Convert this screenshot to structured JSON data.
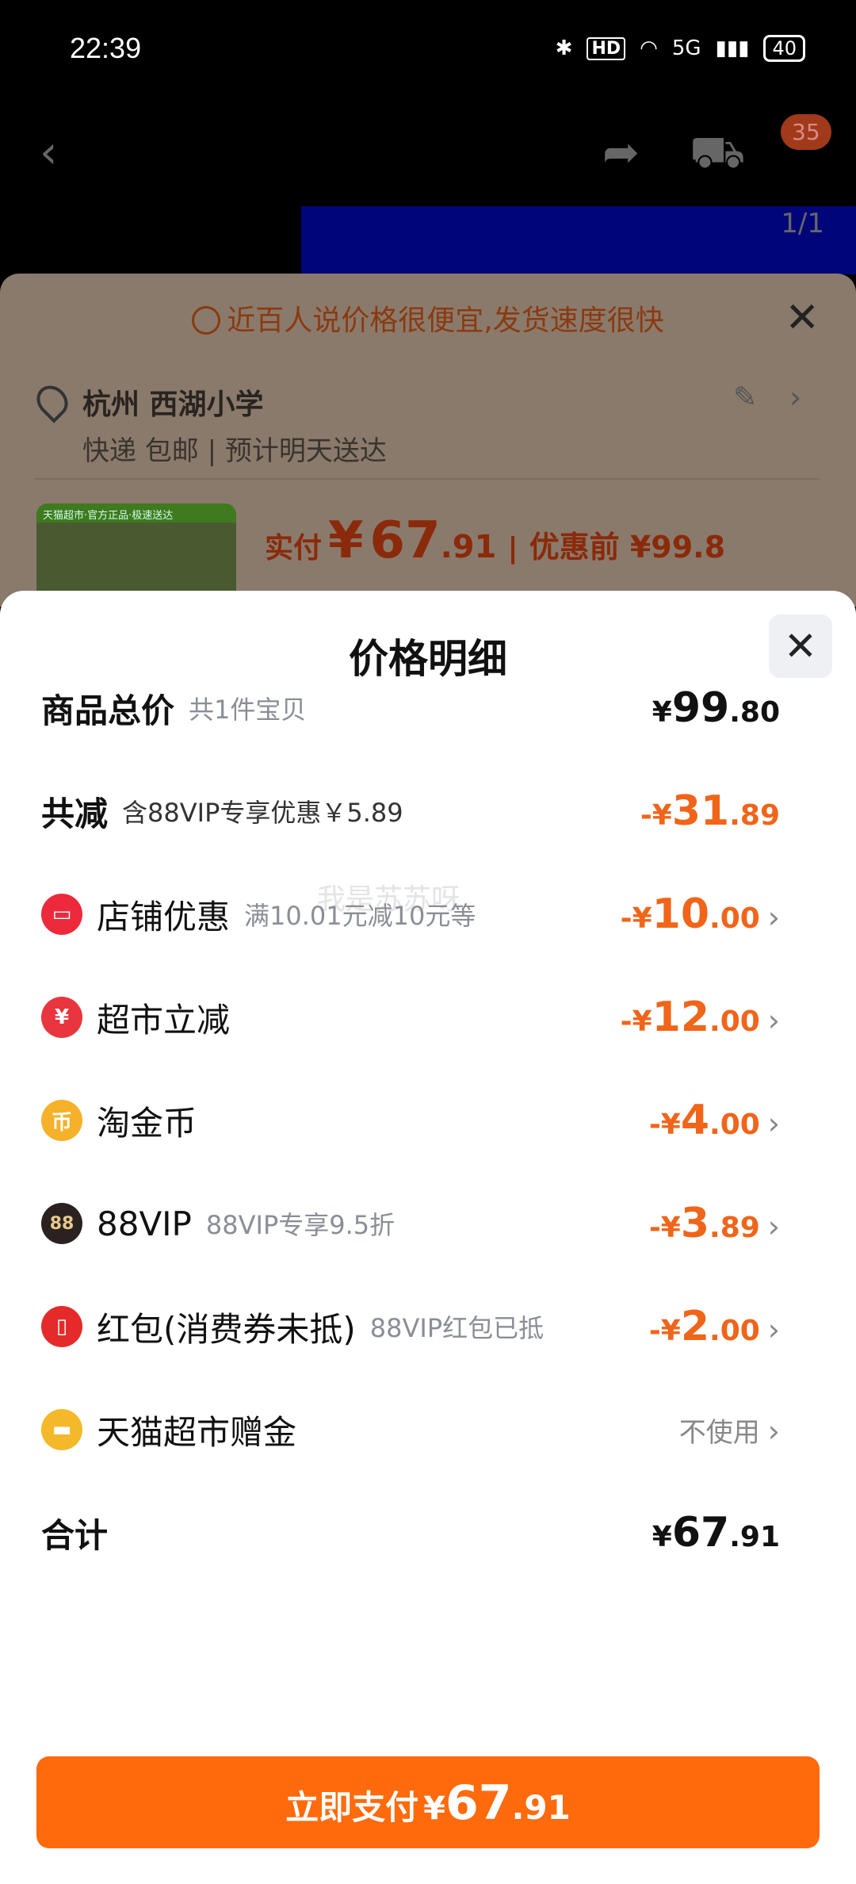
{
  "status_bar": {
    "time": "22:39",
    "bluetooth_icon": "bluetooth-icon",
    "hd": "HD",
    "wifi_icon": "wifi-icon",
    "network": "5G",
    "battery": "40"
  },
  "product_page": {
    "cart_badge": "35",
    "image_counter": "1/1"
  },
  "order_sheet": {
    "notice": "近百人说价格很便宜,发货速度很快",
    "address_title": "杭州 西湖小学",
    "address_sub": "快递 包邮 | 预计明天送达",
    "thumb_banner": "天猫超市·官方正品·极速送达",
    "paid_label": "实付",
    "paid_yen": "¥",
    "paid_int": "67",
    "paid_dec": ".91",
    "paid_before": "优惠前 ¥99.8"
  },
  "modal": {
    "title": "价格明细",
    "watermark": "我是苏苏呀",
    "rows": [
      {
        "label": "商品总价",
        "sub": "共1件宝贝",
        "yen": "¥",
        "int": "99",
        "dec": ".80"
      },
      {
        "label": "共减",
        "sub": "含88VIP专享优惠￥5.89",
        "yen": "-¥",
        "int": "31",
        "dec": ".89"
      },
      {
        "label": "店铺优惠",
        "sub": "满10.01元减10元等",
        "yen": "-¥",
        "int": "10",
        "dec": ".00"
      },
      {
        "label": "超市立减",
        "sub": "",
        "yen": "-¥",
        "int": "12",
        "dec": ".00"
      },
      {
        "label": "淘金币",
        "sub": "",
        "yen": "-¥",
        "int": "4",
        "dec": ".00"
      },
      {
        "label": "88VIP",
        "sub": "88VIP专享9.5折",
        "yen": "-¥",
        "int": "3",
        "dec": ".89"
      },
      {
        "label": "红包(消费券未抵)",
        "sub": "88VIP红包已抵",
        "yen": "-¥",
        "int": "2",
        "dec": ".00"
      },
      {
        "label": "天猫超市赠金",
        "sub": "",
        "right_text": "不使用"
      },
      {
        "label": "合计",
        "sub": "",
        "yen": "¥",
        "int": "67",
        "dec": ".91"
      }
    ],
    "vip_icon_text": "88"
  },
  "pay_button": {
    "label": "立即支付",
    "yen": "¥",
    "int": "67",
    "dec": ".91"
  },
  "colors": {
    "accent": "#ff6a0d",
    "discount": "#f0651a"
  }
}
